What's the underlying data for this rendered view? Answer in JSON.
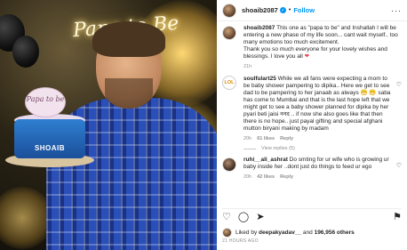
{
  "post": {
    "author": "shoaib2087",
    "follow_label": "Follow",
    "neon_sign": "Papa to Be",
    "topper_text": "Papa to be",
    "cake_label": "SHOAIB",
    "caption": "This one as \"papa to be\" and Inshallah I will be entering a new phase of my life soon... cant wait myself.. too many emotions too much excitement.",
    "caption_2": "Thank you so much everyone for your lovely wishes and blessings. I love you all",
    "caption_time": "21h"
  },
  "comments": [
    {
      "user": "soulfulart25",
      "avatar_text": "LOL",
      "text": "While we all fans were expecting a mom to be baby shower pampering to dipika.. Here we get to see dad to be pampering to her janaab as always 😁 😁 saba has come to Mumbai and that is the last hope left that we might get to see a baby shower planned for dipika by her pyari beti jaisi ननद .. if now she also goes like that then there is no hope.. just payal gifting and special afghani mutton biryani making by madam",
      "time": "20h",
      "likes": "61 likes",
      "reply_label": "Reply",
      "view_replies": "View replies (5)"
    },
    {
      "user": "ruhi__ali_ashrat",
      "text": "Do smting for ur wife who is growing ur baby inside her ..dont just do things to feed ur ego",
      "time": "20h",
      "likes": "42 likes",
      "reply_label": "Reply"
    }
  ],
  "footer": {
    "liked_by_prefix": "Liked by",
    "liked_by_user": "deepakyadav__",
    "liked_by_mid": "and",
    "liked_by_count": "196,956 others",
    "timestamp": "21 HOURS AGO"
  },
  "colors": {
    "accent": "#0095f6",
    "like_red": "#ed4956"
  }
}
